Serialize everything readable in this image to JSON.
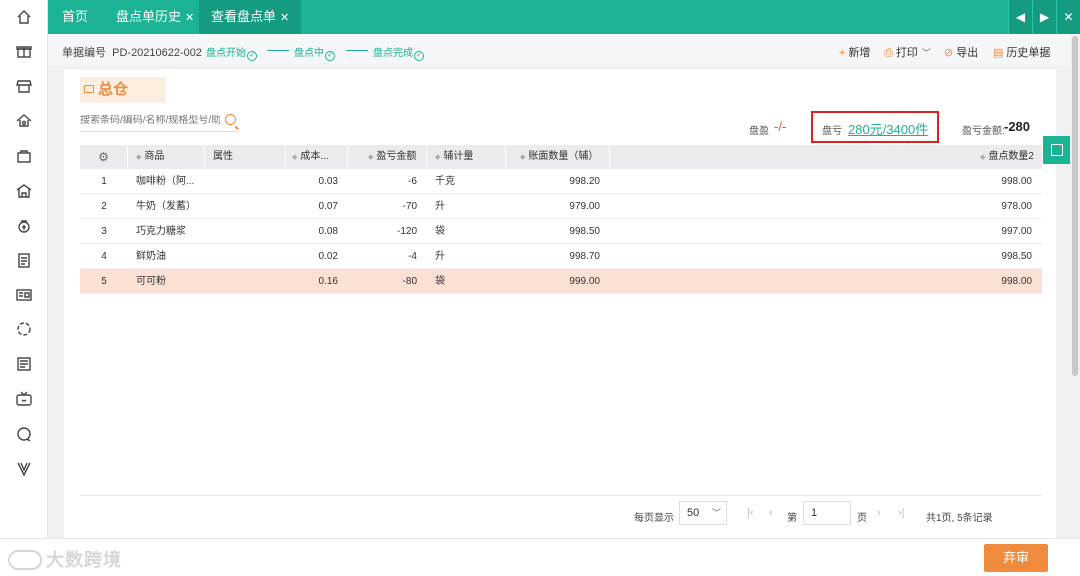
{
  "sidebar": {
    "icons": [
      "home-icon",
      "gift-icon",
      "store-icon",
      "warehouse-icon",
      "bag-icon",
      "house-icon",
      "money-bag-icon",
      "clipboard-icon",
      "id-card-icon",
      "refresh-circle-icon",
      "news-icon",
      "tv-icon",
      "chat-icon",
      "v-logo-icon"
    ]
  },
  "tabs": {
    "home": "首页",
    "history": "盘点单历史",
    "view": "查看盘点单"
  },
  "info": {
    "doc_no_label": "单据编号",
    "doc_no": "PD-20210622-002",
    "steps": [
      "盘点开始",
      "盘点中",
      "盘点完成"
    ],
    "actions": {
      "add": "新增",
      "print": "打印",
      "export": "导出",
      "history": "历史单据"
    }
  },
  "warehouse": "总仓",
  "search": {
    "placeholder": "搜索条码/编码/名称/规格型号/助"
  },
  "summary": {
    "gain_label": "盘盈",
    "gain_value": "-/-",
    "loss_label": "盘亏",
    "loss_value": "280元/3400件",
    "amount_label": "盈亏金额:",
    "amount_value": "-280"
  },
  "table": {
    "headers": {
      "product": "商品",
      "attr": "属性",
      "cost": "成本...",
      "pl_amount": "盈亏金额",
      "aux_unit": "辅计量",
      "book_qty": "账面数量（辅）",
      "count_qty": "盘点数量2"
    },
    "rows": [
      {
        "no": "1",
        "product": "咖啡粉（阿...",
        "attr": "",
        "cost": "0.03",
        "pl": "-6",
        "unit": "千克",
        "book": "998.20",
        "count": "998.00"
      },
      {
        "no": "2",
        "product": "牛奶（发蓄）",
        "attr": "",
        "cost": "0.07",
        "pl": "-70",
        "unit": "升",
        "book": "979.00",
        "count": "978.00"
      },
      {
        "no": "3",
        "product": "巧克力糖浆",
        "attr": "",
        "cost": "0.08",
        "pl": "-120",
        "unit": "袋",
        "book": "998.50",
        "count": "997.00"
      },
      {
        "no": "4",
        "product": "鲜奶油",
        "attr": "",
        "cost": "0.02",
        "pl": "-4",
        "unit": "升",
        "book": "998.70",
        "count": "998.50"
      },
      {
        "no": "5",
        "product": "可可粉",
        "attr": "",
        "cost": "0.16",
        "pl": "-80",
        "unit": "袋",
        "book": "999.00",
        "count": "998.00"
      }
    ]
  },
  "pager": {
    "per_page_label": "每页显示",
    "per_page": "50",
    "page_prefix": "第",
    "page": "1",
    "page_suffix": "页",
    "summary": "共1页, 5条记录"
  },
  "bottom": {
    "logo": "大数跨境",
    "abandon": "弃审"
  },
  "colors": {
    "primary": "#1bb394",
    "accent": "#f08a3c",
    "highlight_row": "#fbe1d4",
    "loss_box": "#e02020"
  }
}
